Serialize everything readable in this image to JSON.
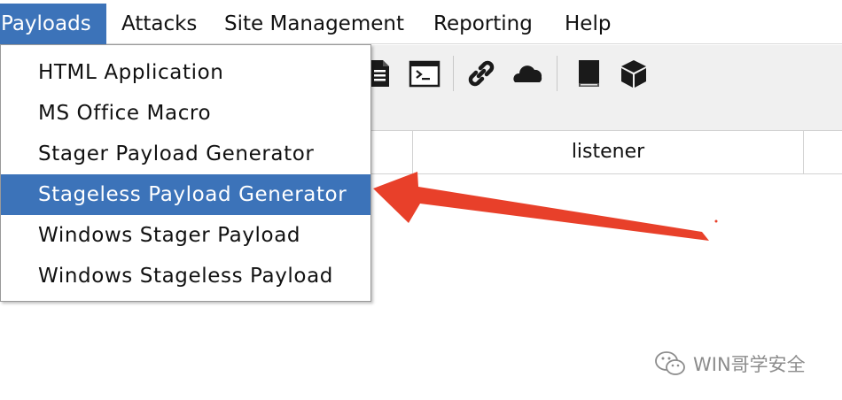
{
  "menubar": {
    "items": [
      {
        "label": "Payloads"
      },
      {
        "label": "Attacks"
      },
      {
        "label": "Site Management"
      },
      {
        "label": "Reporting"
      },
      {
        "label": "Help"
      }
    ]
  },
  "toolbar": {
    "icons": [
      "document-icon",
      "terminal-icon",
      "link-icon",
      "cloud-icon",
      "book-icon",
      "cube-icon"
    ]
  },
  "table": {
    "columns": [
      {
        "label": ""
      },
      {
        "label": "listener"
      }
    ]
  },
  "dropdown": {
    "items": [
      {
        "label": "HTML Application"
      },
      {
        "label": "MS Office Macro"
      },
      {
        "label": "Stager Payload Generator"
      },
      {
        "label": "Stageless Payload Generator"
      },
      {
        "label": "Windows Stager Payload"
      },
      {
        "label": "Windows Stageless Payload"
      }
    ],
    "highlighted": "Stageless Payload Generator"
  },
  "annotation": {
    "arrow_color": "#e8402a"
  },
  "watermark": {
    "text": "WIN哥学安全",
    "icon": "wechat-icon"
  },
  "colors": {
    "selection": "#3c73b9"
  }
}
